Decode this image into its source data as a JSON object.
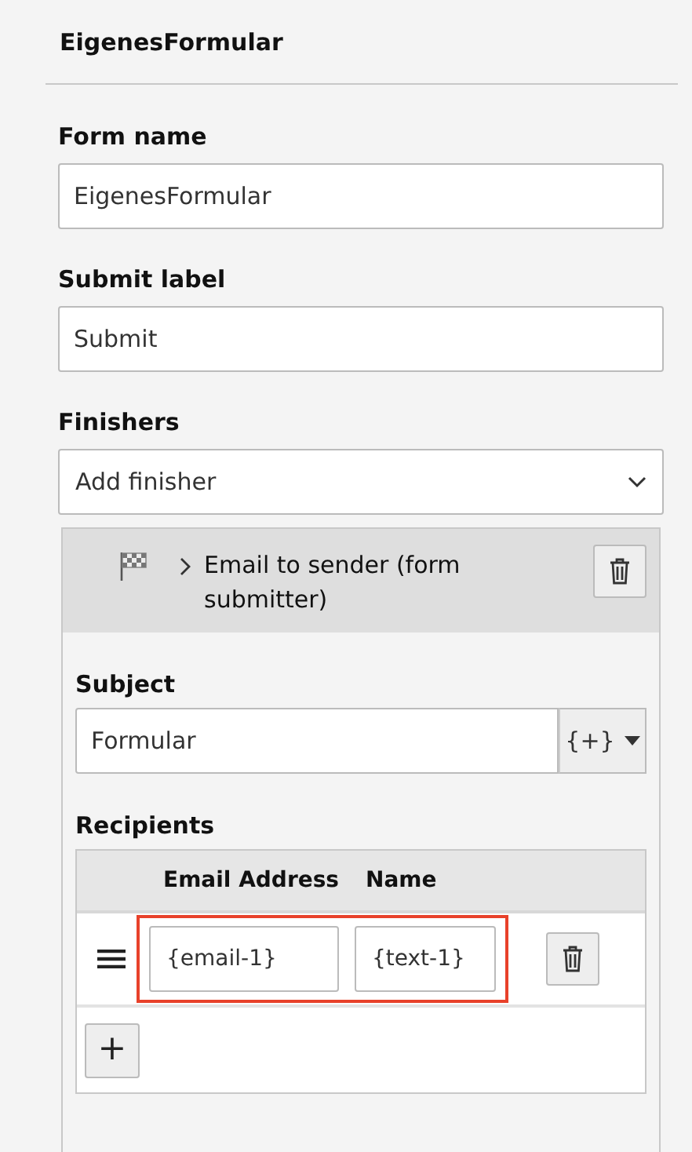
{
  "panel_title": "EigenesFormular",
  "fields": [
    {
      "label": "Form name",
      "value": "EigenesFormular"
    },
    {
      "label": "Submit label",
      "value": "Submit"
    }
  ],
  "finishers": {
    "label": "Finishers",
    "select": {
      "value": "Add finisher"
    }
  },
  "finisher": {
    "title": "Email to sender (form submitter)",
    "expanded": false,
    "subject": {
      "label": "Subject",
      "value": "Formular",
      "insert_button": "{+}"
    },
    "recipients": {
      "label": "Recipients",
      "columns": [
        "Email Address",
        "Name"
      ],
      "rows": [
        {
          "email": "{email-1}",
          "name": "{text-1}",
          "highlighted": true
        }
      ],
      "add_button": "+"
    }
  }
}
